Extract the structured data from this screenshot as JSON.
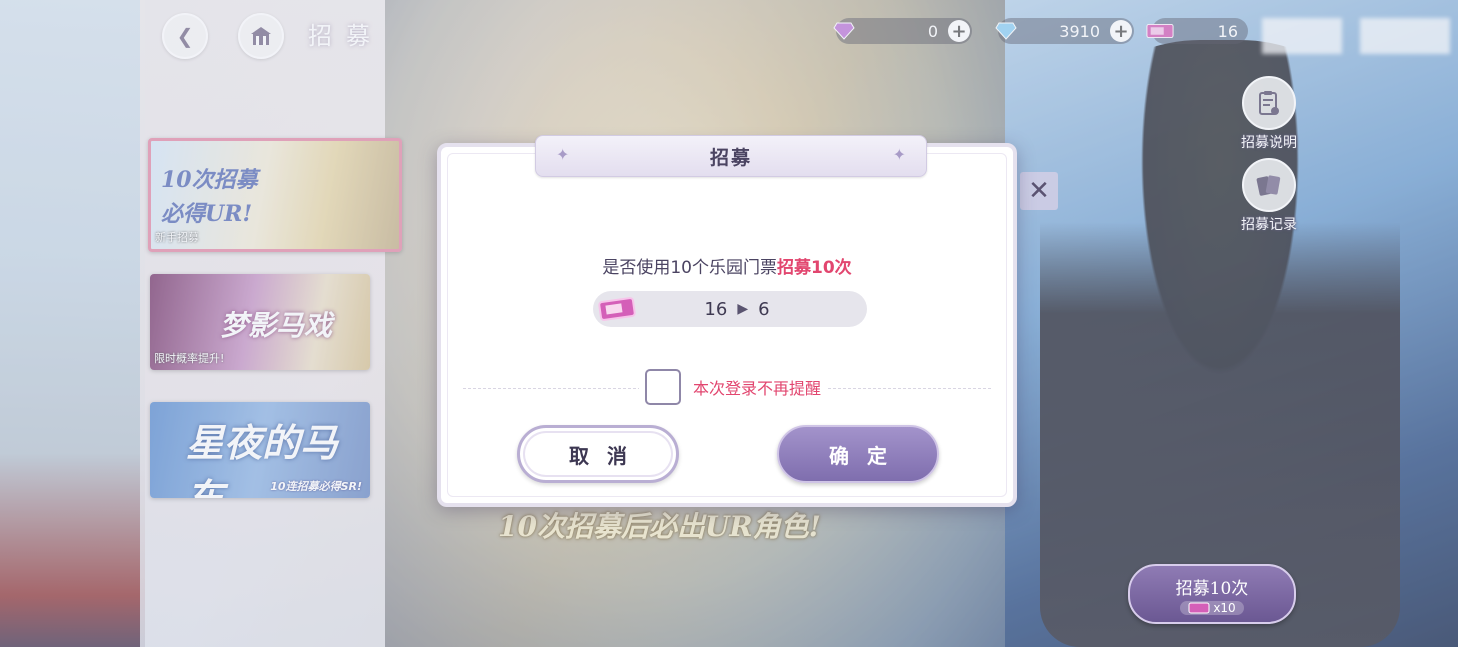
{
  "header": {
    "title": "招募",
    "back_icon": "back-arrow-icon",
    "home_icon": "home-icon"
  },
  "currencies": [
    {
      "icon": "purple-diamond-icon",
      "value": "0",
      "color": "#c07ad8"
    },
    {
      "icon": "blue-diamond-icon",
      "value": "3910",
      "color": "#8fd0f5"
    },
    {
      "icon": "ticket-icon",
      "value": "16",
      "color": "#d45fb8"
    }
  ],
  "side_buttons": [
    {
      "label": "招募说明",
      "icon": "document-icon"
    },
    {
      "label": "招募记录",
      "icon": "cards-icon"
    }
  ],
  "banners": [
    {
      "title": "10次招募\n必得UR!",
      "tag": "新手招募"
    },
    {
      "title": "梦影马戏",
      "tag": "限时概率提升!"
    },
    {
      "title": "星夜的马车",
      "tag": "10连招募必得SR!"
    }
  ],
  "banner_footer_text": "10次招募后必出UR角色!",
  "recruit_button": {
    "label": "招募10次",
    "cost": "x10"
  },
  "modal": {
    "title": "招募",
    "question_prefix": "是否使用10个乐园门票",
    "question_highlight": "招募10次",
    "ticket_from": "16",
    "ticket_to": "6",
    "remember_label": "本次登录不再提醒",
    "cancel_label": "取消",
    "confirm_label": "确定"
  },
  "colors": {
    "accent_pink": "#e2466f",
    "button_purple": "#8f7bb4",
    "text_dark": "#4b4462"
  }
}
